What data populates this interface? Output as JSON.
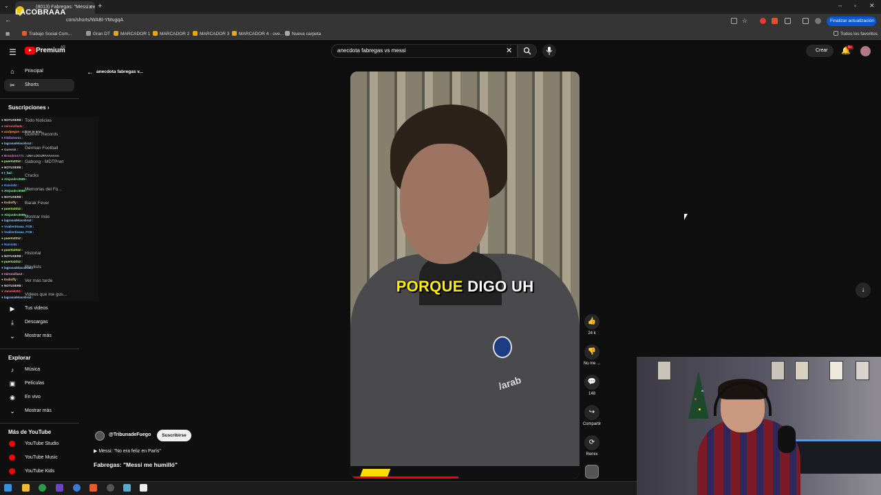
{
  "browser": {
    "tab_title": "(8013) Fabregas: \"Messi me",
    "url": "com/shorts/WABI-YMugqA",
    "update_button": "Finalizar actualización",
    "stream_logo": "LACOBRAAA",
    "bookmarks": [
      "Trabajo Social Com...",
      "Gran DT",
      "MARCADOR 1",
      "MARCADOR 2",
      "MARCADOR 3",
      "MARCADOR 4 - ove...",
      "Nueva carpeta"
    ],
    "bookmarks_all": "Todos los favoritos"
  },
  "youtube": {
    "brand": "Premium",
    "region": "AR",
    "search_value": "anecdota fabregas vs messi",
    "create_label": "Crear",
    "notif_count": "9+"
  },
  "sidebar": {
    "items_top": [
      {
        "label": "Principal",
        "icon": "home-icon"
      },
      {
        "label": "Shorts",
        "icon": "shorts-icon"
      }
    ],
    "subs_title": "Suscripciones",
    "subs_chevron": "›",
    "subs": [
      "Todo Noticias",
      "Gunnin' Records",
      "German Football",
      "Gabong - MDTPnet",
      "Cracks",
      "Memorias del Fú...",
      "Barak Fever",
      "Mostrar más"
    ],
    "you_items": [
      "Historial",
      "Playlists",
      "Ver más tarde",
      "Videos que me gus..."
    ],
    "items_you": [
      {
        "label": "Tus videos",
        "icon": "video-icon"
      },
      {
        "label": "Descargas",
        "icon": "download-icon"
      },
      {
        "label": "Mostrar más",
        "icon": "chevron-down-icon"
      }
    ],
    "explore_title": "Explorar",
    "explore": [
      {
        "label": "Música",
        "icon": "music-icon"
      },
      {
        "label": "Películas",
        "icon": "film-icon"
      },
      {
        "label": "En vivo",
        "icon": "live-icon"
      },
      {
        "label": "Mostrar más",
        "icon": "chevron-down-icon"
      }
    ],
    "more_title": "Más de YouTube",
    "more": [
      "YouTube Studio",
      "YouTube Music",
      "YouTube Kids"
    ]
  },
  "chat": [
    {
      "user": "NOTUSER8 :",
      "msg": "",
      "color": "#e6e6e6"
    },
    {
      "user": "mirnovillada :",
      "msg": "",
      "color": "#ff6b6b"
    },
    {
      "user": "azulpegue :",
      "msg": "cobras te amo",
      "color": "#ff9a3c"
    },
    {
      "user": "frikibdronix :",
      "msg": "",
      "color": "#b48cff"
    },
    {
      "user": "lagrasadelacobra3 :",
      "msg": "",
      "color": "#9ad0ff"
    },
    {
      "user": "Guessis :",
      "msg": "",
      "color": "#c0c0c0"
    },
    {
      "user": "Brandon1771 :",
      "msg": "UNA LOCURAAAAAAA",
      "color": "#ff6bd5"
    },
    {
      "user": "puerto2012 :",
      "msg": "",
      "color": "#c8ff6b"
    },
    {
      "user": "NOTUSER8 :",
      "msg": "",
      "color": "#e6e6e6"
    },
    {
      "user": "t_bul :",
      "msg": "",
      "color": "#8cf0ff"
    },
    {
      "user": "Alejandro3599 :",
      "msg": "",
      "color": "#6bff8e"
    },
    {
      "user": "Ramis84 :",
      "msg": "",
      "color": "#6ba4ff"
    },
    {
      "user": "Alejandro3599 :",
      "msg": "",
      "color": "#6bff8e"
    },
    {
      "user": "NOTUSER8 :",
      "msg": "",
      "color": "#e6e6e6"
    },
    {
      "user": "Exdioffy :",
      "msg": "",
      "color": "#ffcc6b"
    },
    {
      "user": "puerto2012 :",
      "msg": "",
      "color": "#c8ff6b"
    },
    {
      "user": "Alejandro3599 :",
      "msg": "",
      "color": "#6bff8e"
    },
    {
      "user": "lagrasadelacobra3 :",
      "msg": "",
      "color": "#9ad0ff"
    },
    {
      "user": "Vvalientinaaa_FCB :",
      "msg": "",
      "color": "#6bc1ff"
    },
    {
      "user": "Vvalientinaaa_FCB :",
      "msg": "",
      "color": "#6bc1ff"
    },
    {
      "user": "puerto2012 :",
      "msg": "",
      "color": "#c8ff6b"
    },
    {
      "user": "Ramis84 :",
      "msg": "",
      "color": "#6ba4ff"
    },
    {
      "user": "puerto2012 :",
      "msg": "",
      "color": "#c8ff6b"
    },
    {
      "user": "NOTUSER8 :",
      "msg": "",
      "color": "#e6e6e6"
    },
    {
      "user": "puerto2012 :",
      "msg": "",
      "color": "#c8ff6b"
    },
    {
      "user": "lagrasadelacobra3 :",
      "msg": "",
      "color": "#9ad0ff"
    },
    {
      "user": "mirnovillas3 :",
      "msg": "",
      "color": "#ff9ae0"
    },
    {
      "user": "Exdioffy :",
      "msg": "",
      "color": "#ffcc6b"
    },
    {
      "user": "NOTUSER8 :",
      "msg": "",
      "color": "#e6e6e6"
    },
    {
      "user": "Jamee6251 :",
      "msg": "",
      "color": "#ff6b6b"
    },
    {
      "user": "lagrasadelacobra3 :",
      "msg": "",
      "color": "#9ad0ff"
    }
  ],
  "short": {
    "back_title": "anecdota fabregas v...",
    "caption_yellow": "PORQUE",
    "caption_white": "DIGO UH",
    "progress_fraction": 0.47,
    "channel": "@TribunadeFuego",
    "subscribe": "Suscribirse",
    "subtitle_line": "Messi: \"No era feliz en París\"",
    "title": "Fabregas: \"Messi me humilló\"",
    "actions": [
      {
        "icon": "like-icon",
        "glyph": "👍",
        "label": "24 k"
      },
      {
        "icon": "dislike-icon",
        "glyph": "👎",
        "label": "No me ..."
      },
      {
        "icon": "comment-icon",
        "glyph": "💬",
        "label": "148"
      },
      {
        "icon": "share-icon",
        "glyph": "↪",
        "label": "Compartir"
      },
      {
        "icon": "remix-icon",
        "glyph": "⟳",
        "label": "Remix"
      }
    ]
  },
  "colors": {
    "accent_red": "#ff0000",
    "caption_yellow": "#ffee00",
    "update_blue": "#0b57d0"
  }
}
